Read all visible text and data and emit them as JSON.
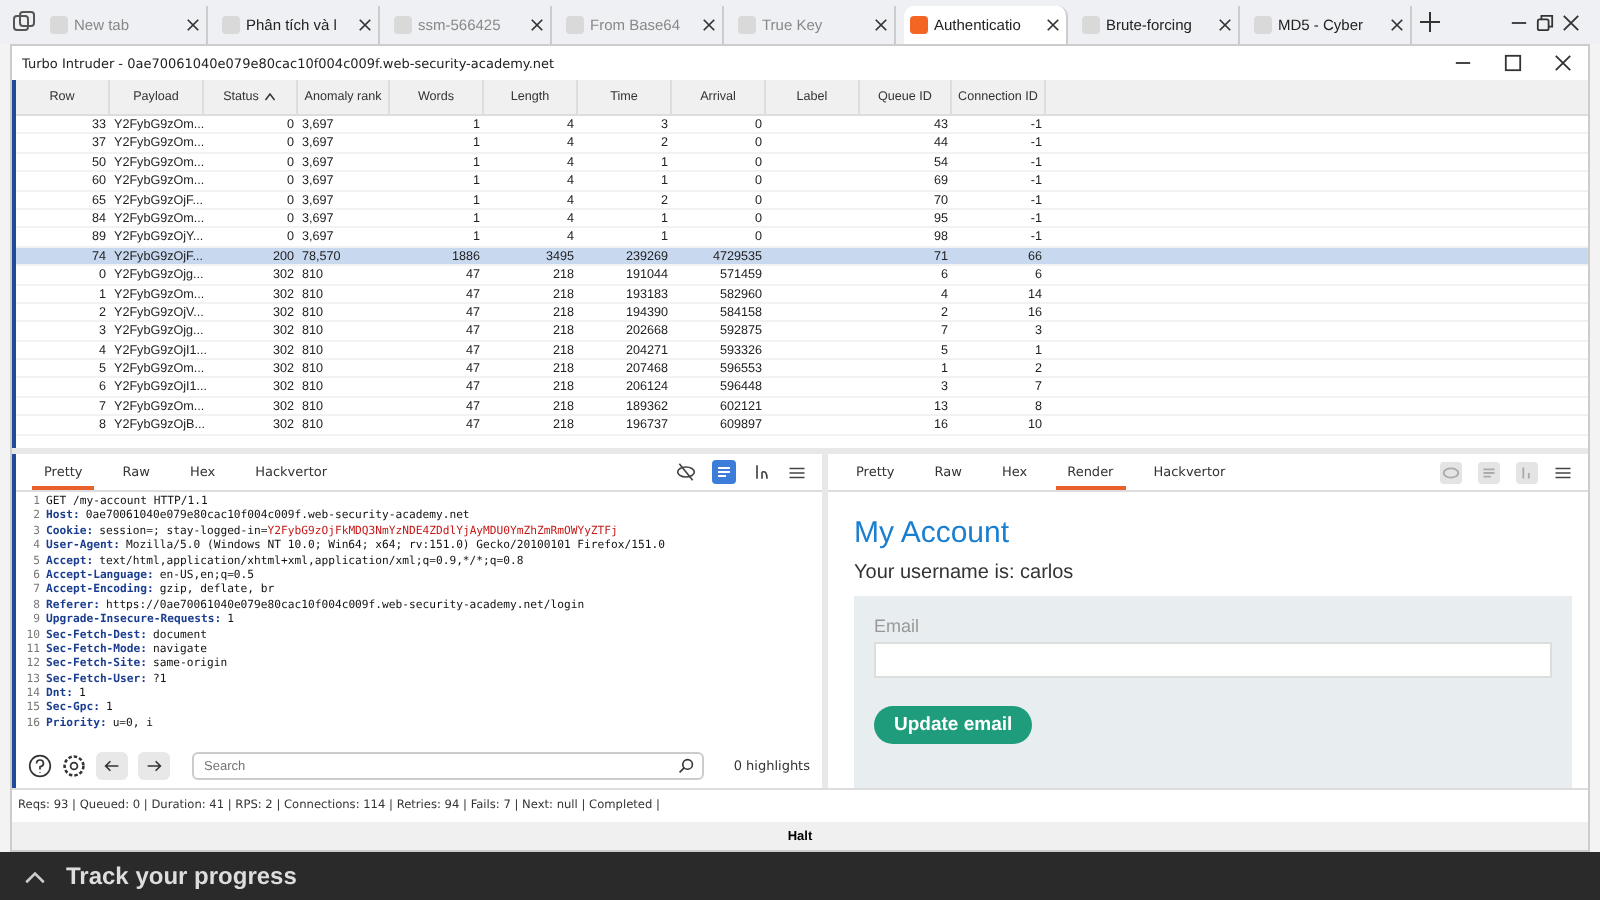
{
  "browser_tabs": [
    {
      "label": "New tab",
      "selected": false,
      "faded": true
    },
    {
      "label": "Phân tích và l",
      "selected": false,
      "faded": false
    },
    {
      "label": "ssm-566425",
      "selected": false,
      "faded": true
    },
    {
      "label": "From Base64",
      "selected": false,
      "faded": true
    },
    {
      "label": "True Key",
      "selected": false,
      "faded": true
    },
    {
      "label": "Authenticatio",
      "selected": true,
      "faded": false
    },
    {
      "label": "Brute-forcing",
      "selected": false,
      "faded": false
    },
    {
      "label": "MD5 - Cyber",
      "selected": false,
      "faded": false
    }
  ],
  "window": {
    "title": "Turbo Intruder - 0ae70061040e079e80cac10f004c009f.web-security-academy.net"
  },
  "table": {
    "columns": [
      {
        "label": "Row",
        "sorted": false
      },
      {
        "label": "Payload",
        "sorted": false
      },
      {
        "label": "Status",
        "sorted": true
      },
      {
        "label": "Anomaly rank",
        "sorted": false
      },
      {
        "label": "Words",
        "sorted": false
      },
      {
        "label": "Length",
        "sorted": false
      },
      {
        "label": "Time",
        "sorted": false
      },
      {
        "label": "Arrival",
        "sorted": false
      },
      {
        "label": "Label",
        "sorted": false
      },
      {
        "label": "Queue ID",
        "sorted": false
      },
      {
        "label": "Connection ID",
        "sorted": false
      }
    ],
    "rows": [
      {
        "cells": [
          "33",
          "Y2FybG9zOm...",
          "0",
          "3,697",
          "1",
          "4",
          "3",
          "0",
          "",
          "43",
          "-1"
        ],
        "selected": false
      },
      {
        "cells": [
          "37",
          "Y2FybG9zOm...",
          "0",
          "3,697",
          "1",
          "4",
          "2",
          "0",
          "",
          "44",
          "-1"
        ],
        "selected": false
      },
      {
        "cells": [
          "50",
          "Y2FybG9zOm...",
          "0",
          "3,697",
          "1",
          "4",
          "1",
          "0",
          "",
          "54",
          "-1"
        ],
        "selected": false
      },
      {
        "cells": [
          "60",
          "Y2FybG9zOm...",
          "0",
          "3,697",
          "1",
          "4",
          "1",
          "0",
          "",
          "69",
          "-1"
        ],
        "selected": false
      },
      {
        "cells": [
          "65",
          "Y2FybG9zOjF...",
          "0",
          "3,697",
          "1",
          "4",
          "2",
          "0",
          "",
          "70",
          "-1"
        ],
        "selected": false
      },
      {
        "cells": [
          "84",
          "Y2FybG9zOm...",
          "0",
          "3,697",
          "1",
          "4",
          "1",
          "0",
          "",
          "95",
          "-1"
        ],
        "selected": false
      },
      {
        "cells": [
          "89",
          "Y2FybG9zOjY...",
          "0",
          "3,697",
          "1",
          "4",
          "1",
          "0",
          "",
          "98",
          "-1"
        ],
        "selected": false
      },
      {
        "cells": [
          "74",
          "Y2FybG9zOjF...",
          "200",
          "78,570",
          "1886",
          "3495",
          "239269",
          "4729535",
          "",
          "71",
          "66"
        ],
        "selected": true
      },
      {
        "cells": [
          "0",
          "Y2FybG9zOjg...",
          "302",
          "810",
          "47",
          "218",
          "191044",
          "571459",
          "",
          "6",
          "6"
        ],
        "selected": false
      },
      {
        "cells": [
          "1",
          "Y2FybG9zOm...",
          "302",
          "810",
          "47",
          "218",
          "193183",
          "582960",
          "",
          "4",
          "14"
        ],
        "selected": false
      },
      {
        "cells": [
          "2",
          "Y2FybG9zOjV...",
          "302",
          "810",
          "47",
          "218",
          "194390",
          "584158",
          "",
          "2",
          "16"
        ],
        "selected": false
      },
      {
        "cells": [
          "3",
          "Y2FybG9zOjg...",
          "302",
          "810",
          "47",
          "218",
          "202668",
          "592875",
          "",
          "7",
          "3"
        ],
        "selected": false
      },
      {
        "cells": [
          "4",
          "Y2FybG9zOjI1...",
          "302",
          "810",
          "47",
          "218",
          "204271",
          "593326",
          "",
          "5",
          "1"
        ],
        "selected": false
      },
      {
        "cells": [
          "5",
          "Y2FybG9zOm...",
          "302",
          "810",
          "47",
          "218",
          "207468",
          "596553",
          "",
          "1",
          "2"
        ],
        "selected": false
      },
      {
        "cells": [
          "6",
          "Y2FybG9zOjI1...",
          "302",
          "810",
          "47",
          "218",
          "206124",
          "596448",
          "",
          "3",
          "7"
        ],
        "selected": false
      },
      {
        "cells": [
          "7",
          "Y2FybG9zOm...",
          "302",
          "810",
          "47",
          "218",
          "189362",
          "602121",
          "",
          "13",
          "8"
        ],
        "selected": false
      },
      {
        "cells": [
          "8",
          "Y2FybG9zOjB...",
          "302",
          "810",
          "47",
          "218",
          "196737",
          "609897",
          "",
          "16",
          "10"
        ],
        "selected": false
      }
    ]
  },
  "request": {
    "tabs": [
      {
        "label": "Pretty",
        "selected": true
      },
      {
        "label": "Raw",
        "selected": false
      },
      {
        "label": "Hex",
        "selected": false
      },
      {
        "label": "Hackvertor",
        "selected": false
      }
    ],
    "lines": [
      {
        "num": "1",
        "value": "GET /my-account HTTP/1.1"
      },
      {
        "num": "2",
        "name": "Host:",
        "value": "0ae70061040e079e80cac10f004c009f.web-security-academy.net"
      },
      {
        "num": "3",
        "name": "Cookie:",
        "value": "session=; stay-logged-in=",
        "secret": "Y2FybG9zOjFkMDQ3NmYzNDE4ZDdlYjAyMDU0YmZhZmRmOWYyZTFj"
      },
      {
        "num": "4",
        "name": "User-Agent:",
        "value": "Mozilla/5.0 (Windows NT 10.0; Win64; x64; rv:151.0) Gecko/20100101 Firefox/151.0"
      },
      {
        "num": "5",
        "name": "Accept:",
        "value": "text/html,application/xhtml+xml,application/xml;q=0.9,*/*;q=0.8"
      },
      {
        "num": "6",
        "name": "Accept-Language:",
        "value": "en-US,en;q=0.5"
      },
      {
        "num": "7",
        "name": "Accept-Encoding:",
        "value": "gzip, deflate, br"
      },
      {
        "num": "8",
        "name": "Referer:",
        "value": "https://0ae70061040e079e80cac10f004c009f.web-security-academy.net/login"
      },
      {
        "num": "9",
        "name": "Upgrade-Insecure-Requests:",
        "value": "1"
      },
      {
        "num": "10",
        "name": "Sec-Fetch-Dest:",
        "value": "document"
      },
      {
        "num": "11",
        "name": "Sec-Fetch-Mode:",
        "value": "navigate"
      },
      {
        "num": "12",
        "name": "Sec-Fetch-Site:",
        "value": "same-origin"
      },
      {
        "num": "13",
        "name": "Sec-Fetch-User:",
        "value": "?1"
      },
      {
        "num": "14",
        "name": "Dnt:",
        "value": "1"
      },
      {
        "num": "15",
        "name": "Sec-Gpc:",
        "value": "1"
      },
      {
        "num": "16",
        "name": "Priority:",
        "value": "u=0, i"
      }
    ],
    "search": {
      "placeholder": "Search"
    },
    "highlights": "0 highlights"
  },
  "response": {
    "tabs": [
      {
        "label": "Pretty",
        "selected": false
      },
      {
        "label": "Raw",
        "selected": false
      },
      {
        "label": "Hex",
        "selected": false
      },
      {
        "label": "Render",
        "selected": true
      },
      {
        "label": "Hackvertor",
        "selected": false
      }
    ],
    "heading": "My Account",
    "username_text": "Your username is: carlos",
    "email_label": "Email",
    "button": "Update email"
  },
  "status_bar": "Reqs: 93 | Queued: 0 | Duration: 41 | RPS: 2 | Connections: 114 | Retries: 94 | Fails: 7 | Next: null | Completed |",
  "halt_button": "Halt",
  "background_banner": "Track your progress"
}
